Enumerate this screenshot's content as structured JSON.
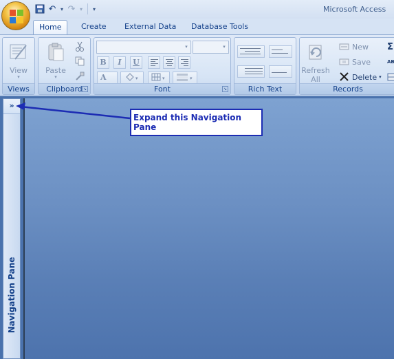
{
  "window": {
    "title": "Microsoft Access"
  },
  "quick_access": {
    "undo": "↶",
    "redo": "↷",
    "more": "▾"
  },
  "tabs": [
    {
      "label": "Home",
      "active": true
    },
    {
      "label": "Create"
    },
    {
      "label": "External Data"
    },
    {
      "label": "Database Tools"
    }
  ],
  "ribbon": {
    "views": {
      "label": "Views",
      "view_button": "View"
    },
    "clipboard": {
      "label": "Clipboard",
      "paste_button": "Paste"
    },
    "font": {
      "label": "Font",
      "bold": "B",
      "italic": "I",
      "underline": "U",
      "font_color": "A"
    },
    "rich_text": {
      "label": "Rich Text"
    },
    "records": {
      "label": "Records",
      "refresh_button": "Refresh",
      "refresh_all": "All",
      "new_button": "New",
      "save_button": "Save",
      "delete_button": "Delete"
    }
  },
  "nav_pane": {
    "label": "Navigation Pane",
    "expand_glyph": "»"
  },
  "callout": {
    "text": "Expand this Navigation Pane"
  },
  "colors": {
    "accent": "#15428b",
    "callout": "#1c2cb3",
    "workspace": "#5a7fb6"
  }
}
